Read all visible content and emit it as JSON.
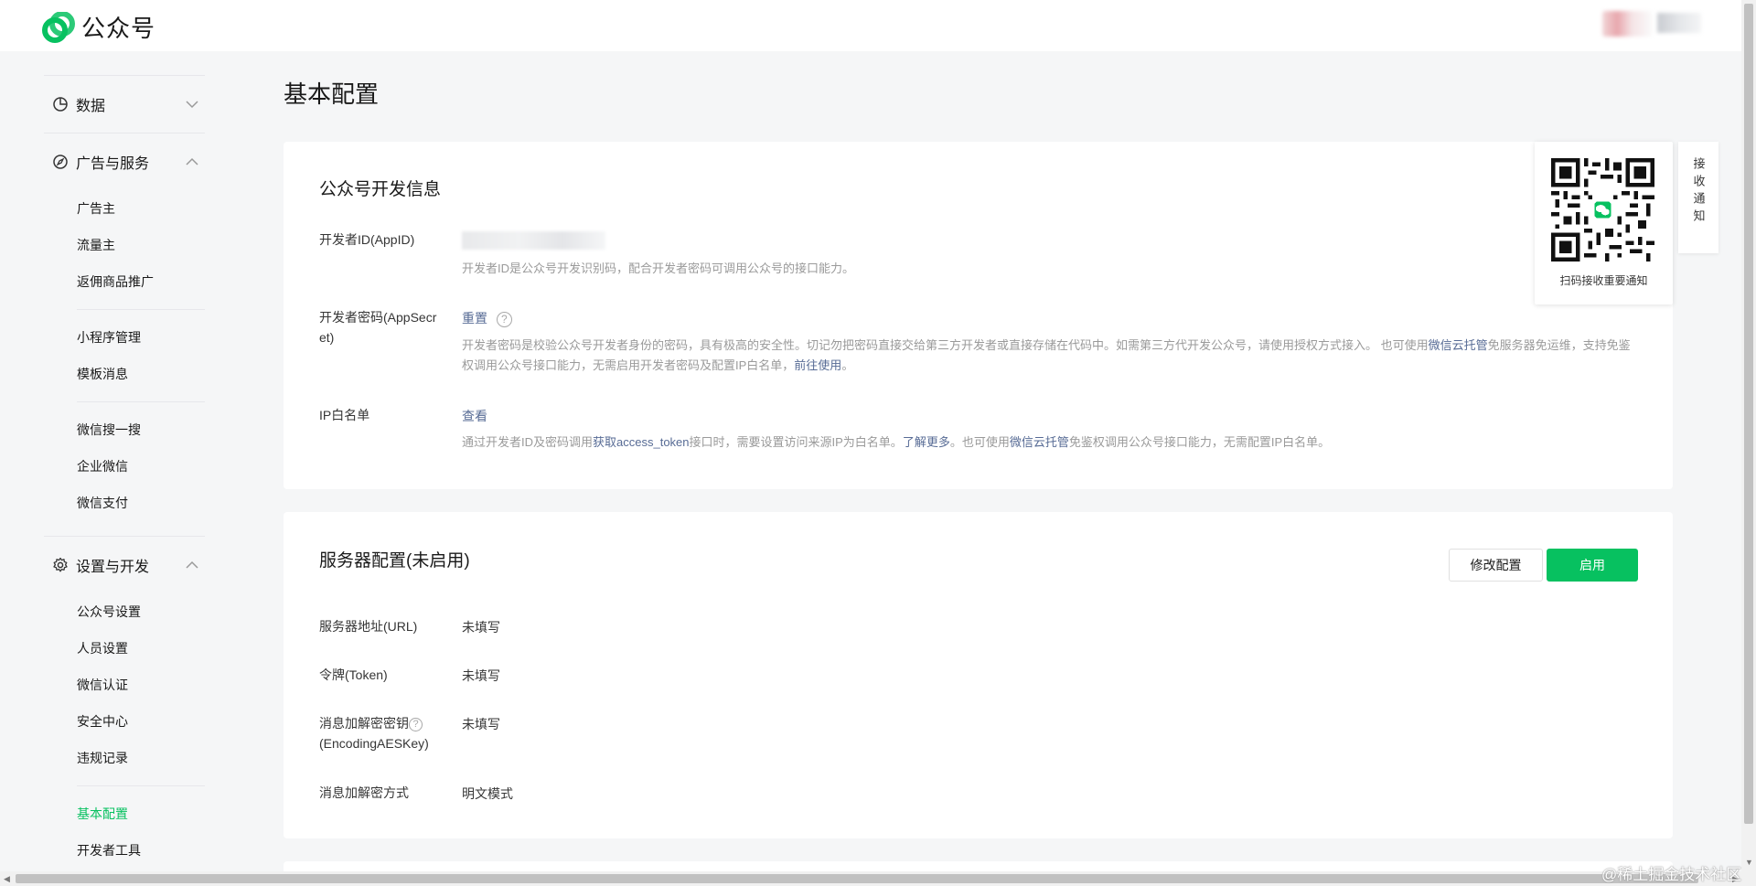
{
  "brand": {
    "name": "公众号",
    "accent": "#07c160",
    "link_color": "#576b95"
  },
  "sidebar": {
    "groups": [
      {
        "label": "数据",
        "icon": "pie-chart-icon",
        "expanded": false
      },
      {
        "label": "广告与服务",
        "icon": "compass-icon",
        "expanded": true,
        "items": [
          "广告主",
          "流量主",
          "返佣商品推广",
          "小程序管理",
          "模板消息",
          "微信搜一搜",
          "企业微信",
          "微信支付"
        ]
      },
      {
        "label": "设置与开发",
        "icon": "gear-icon",
        "expanded": true,
        "items": [
          "公众号设置",
          "人员设置",
          "微信认证",
          "安全中心",
          "违规记录",
          "基本配置",
          "开发者工具"
        ]
      }
    ],
    "active_item": "基本配置"
  },
  "page": {
    "title": "基本配置"
  },
  "dev_info": {
    "title": "公众号开发信息",
    "appid": {
      "label": "开发者ID(AppID)",
      "desc": "开发者ID是公众号开发识别码，配合开发者密码可调用公众号的接口能力。"
    },
    "secret": {
      "label": "开发者密码(AppSecret)",
      "action": "重置",
      "help": "?",
      "desc_1": "开发者密码是校验公众号开发者身份的密码，具有极高的安全性。切记勿把密码直接交给第三方开发者或直接存储在代码中。如需第三方代开发公众号，请使用授权方式接入。 也可使用",
      "link_cloud": "微信云托管",
      "desc_2": "免服务器免运维，支持免鉴权调用公众号接口能力，无需启用开发者密码及配置IP白名单，",
      "link_go": "前往使用",
      "desc_3": "。"
    },
    "ip": {
      "label": "IP白名单",
      "action": "查看",
      "desc_1": "通过开发者ID及密码调用",
      "link_token": "获取access_token",
      "desc_2": "接口时，需要设置访问来源IP为白名单。",
      "link_more": "了解更多",
      "desc_3": "。也可使用",
      "link_cloud": "微信云托管",
      "desc_4": "免鉴权调用公众号接口能力，无需配置IP白名单。"
    }
  },
  "server": {
    "title": "服务器配置(未启用)",
    "btn_modify": "修改配置",
    "btn_enable": "启用",
    "rows": [
      {
        "label": "服务器地址(URL)",
        "value": "未填写"
      },
      {
        "label": "令牌(Token)",
        "value": "未填写"
      },
      {
        "label": "消息加解密密钥",
        "label2": "(EncodingAESKey)",
        "value": "未填写"
      },
      {
        "label": "消息加解密方式",
        "value": "明文模式"
      }
    ]
  },
  "qr": {
    "caption": "扫码接收重要通知",
    "tab_label": "接收通知"
  },
  "watermark": "@稀土掘金技术社区"
}
